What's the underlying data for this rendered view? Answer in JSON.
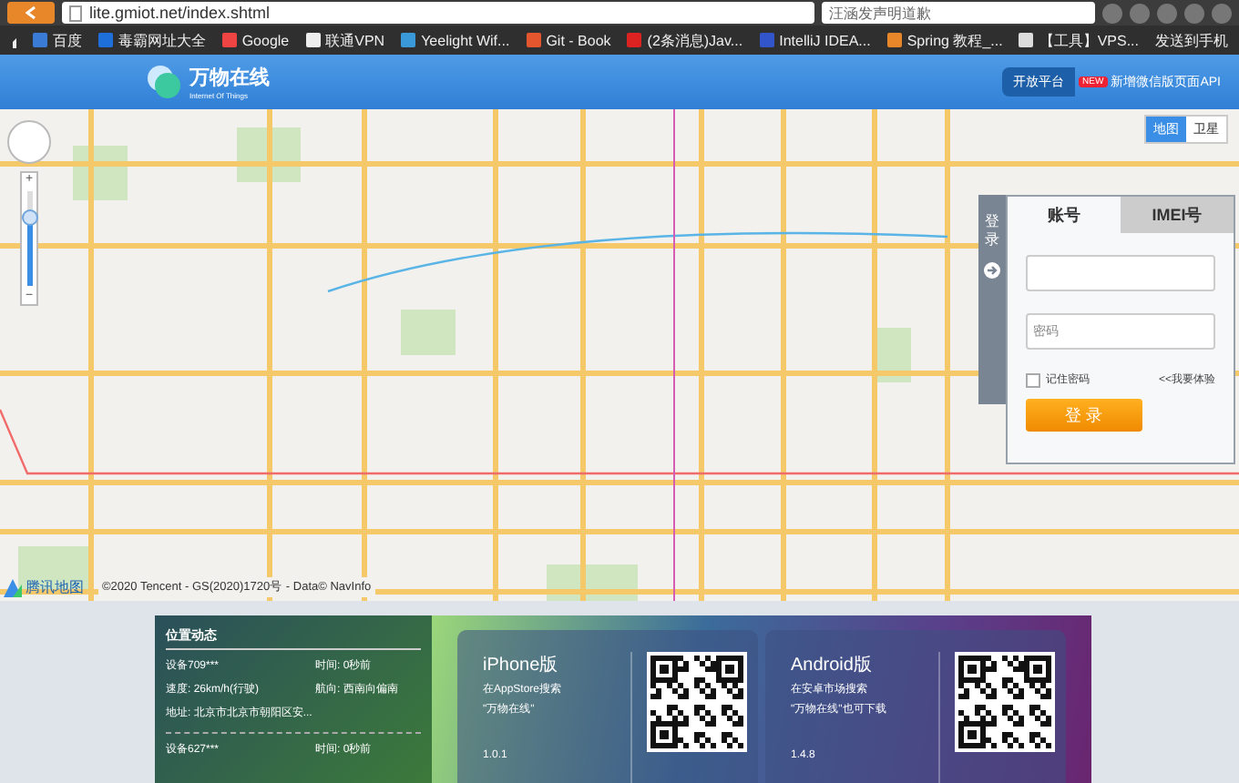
{
  "browser": {
    "url": "lite.gmiot.net/index.shtml",
    "search_placeholder": "汪涵发声明道歉",
    "bookmarks": [
      "百度",
      "毒霸网址大全",
      "Google",
      "联通VPN",
      "Yeelight Wif...",
      "Git - Book",
      "(2条消息)Jav...",
      "IntelliJ IDEA...",
      "Spring 教程_...",
      "【工具】VPS..."
    ],
    "send_to_phone": "发送到手机"
  },
  "header": {
    "logo_title": "万物在线",
    "logo_subtitle": "Internet Of Things",
    "open_platform": "开放平台",
    "new_badge": "NEW",
    "announcement": "新增微信版页面API"
  },
  "map": {
    "layer_tabs": [
      {
        "label": "地图",
        "selected": true
      },
      {
        "label": "卫星",
        "selected": false
      }
    ],
    "zoom": {
      "level": 0.72,
      "zoom_in": "+",
      "zoom_out": "−"
    },
    "brand": "腾讯地图",
    "copyright": "©2020 Tencent - GS(2020)1720号 - Data© NavInfo"
  },
  "login": {
    "side_tab": "登录",
    "tabs": [
      {
        "label": "账号",
        "selected": true
      },
      {
        "label": "IMEI号",
        "selected": false
      }
    ],
    "password_placeholder": "密码",
    "remember": {
      "label": "记住密码",
      "checked": false
    },
    "trial_link": "<<我要体验",
    "submit": "登 录"
  },
  "feed": {
    "title": "位置动态",
    "devices": [
      {
        "device": "设备709***",
        "time": "时间: 0秒前",
        "speed": "速度: 26km/h(行驶)",
        "heading": "航向: 西南向偏南",
        "address": "地址: 北京市北京市朝阳区安..."
      },
      {
        "device": "设备627***",
        "time": "时间: 0秒前"
      }
    ]
  },
  "apps": [
    {
      "title": "iPhone版",
      "line1": "在AppStore搜索",
      "line2": "\"万物在线\"",
      "version": "1.0.1"
    },
    {
      "title": "Android版",
      "line1": "在安卓市场搜索",
      "line2": "\"万物在线\"也可下载",
      "version": "1.4.8"
    }
  ]
}
